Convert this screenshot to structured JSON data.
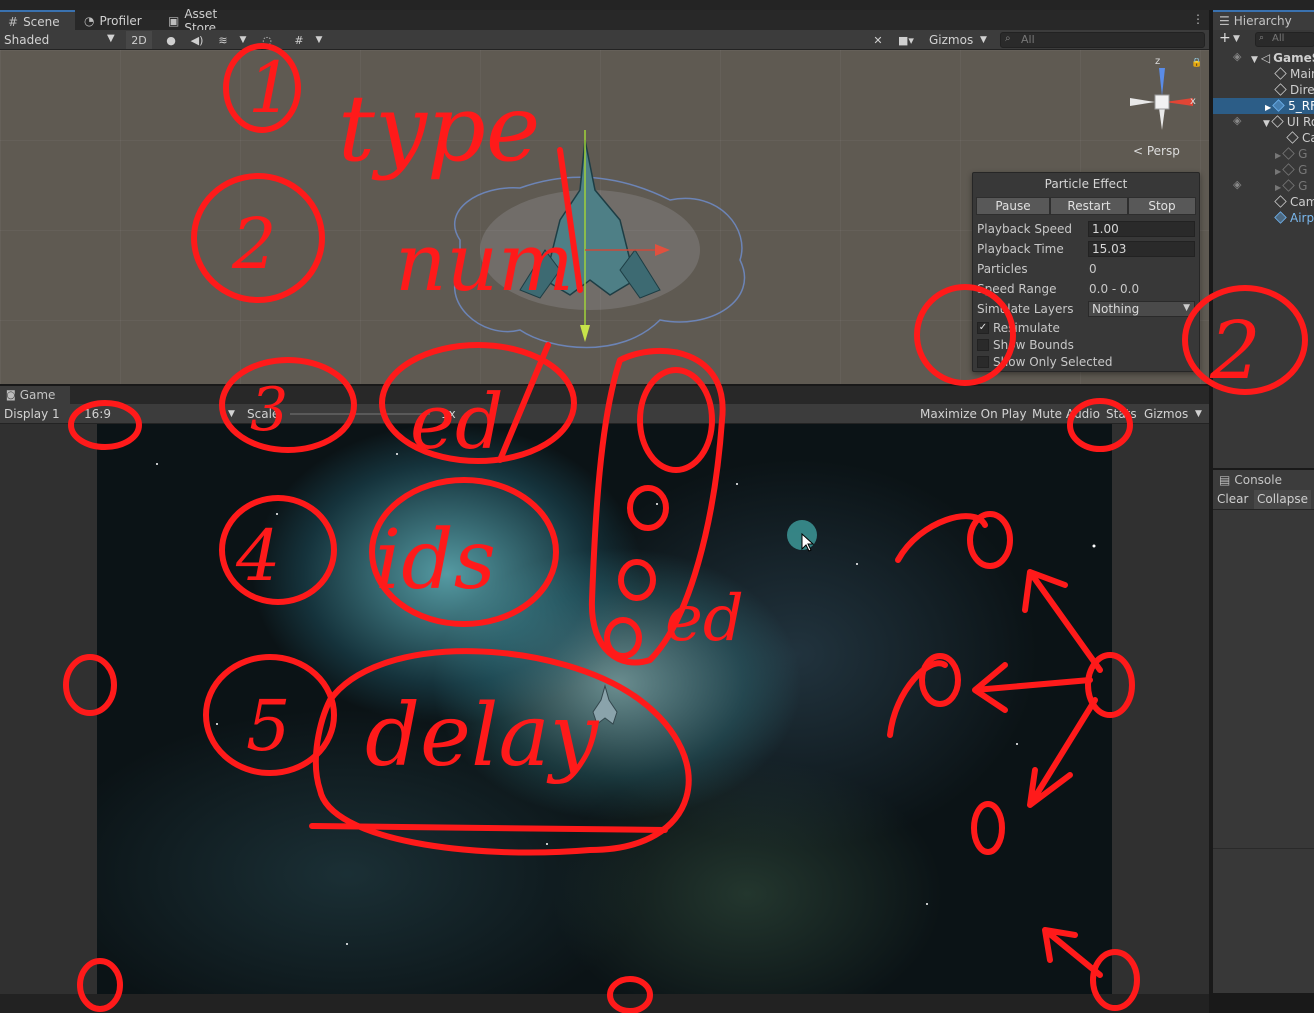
{
  "tabs": {
    "scene": "Scene",
    "profiler": "Profiler",
    "asset_store": "Asset Store",
    "game": "Game",
    "hierarchy": "Hierarchy",
    "console": "Console"
  },
  "scene_toolbar": {
    "shading_mode": "Shaded",
    "toggle_2d": "2D",
    "gizmos": "Gizmos",
    "search_placeholder": "All"
  },
  "orientation_gizmo": {
    "y_axis": "z",
    "x_axis": "x",
    "projection": "< Persp"
  },
  "particle_effect": {
    "title": "Particle Effect",
    "pause": "Pause",
    "restart": "Restart",
    "stop": "Stop",
    "playback_speed_label": "Playback Speed",
    "playback_speed": "1.00",
    "playback_time_label": "Playback Time",
    "playback_time": "15.03",
    "particles_label": "Particles",
    "particles": "0",
    "speed_range_label": "Speed Range",
    "speed_range": "0.0 - 0.0",
    "simulate_layers_label": "Simulate Layers",
    "simulate_layers": "Nothing",
    "resimulate": "Resimulate",
    "resimulate_checked": true,
    "show_bounds": "Show Bounds",
    "show_only_selected": "Show Only Selected"
  },
  "game_toolbar": {
    "display": "Display 1",
    "aspect": "16:9",
    "scale_label": "Scale",
    "scale_value": "1x",
    "maximize_on_play": "Maximize On Play",
    "mute_audio": "Mute Audio",
    "stats": "Stats",
    "gizmos": "Gizmos"
  },
  "hierarchy": {
    "search_placeholder": "All",
    "items": [
      {
        "label": "GameS",
        "level": 0,
        "type": "scene"
      },
      {
        "label": "Main",
        "level": 1,
        "type": "object"
      },
      {
        "label": "Direc",
        "level": 1,
        "type": "object"
      },
      {
        "label": "5_RF",
        "level": 1,
        "type": "prefab",
        "selected": true
      },
      {
        "label": "UI Ro",
        "level": 1,
        "type": "object"
      },
      {
        "label": "Ca",
        "level": 2,
        "type": "object"
      },
      {
        "label": "G",
        "level": 2,
        "type": "dim"
      },
      {
        "label": "G",
        "level": 2,
        "type": "dim"
      },
      {
        "label": "G",
        "level": 2,
        "type": "dim"
      },
      {
        "label": "Cam",
        "level": 1,
        "type": "object"
      },
      {
        "label": "Airpl",
        "level": 1,
        "type": "prefab"
      }
    ]
  },
  "console": {
    "clear": "Clear",
    "collapse": "Collapse"
  },
  "annotation_notes": {
    "n1": "1",
    "type": "type",
    "n2a": "2",
    "num": "num",
    "n2b": "2",
    "n3": "3",
    "ed": "ed",
    "n4": "4",
    "ids": "ids",
    "n5": "5",
    "delay": "delay",
    "ed2": "ed"
  },
  "colors": {
    "ink": "#ff0000",
    "selection": "#2c5d87",
    "panel": "#383838"
  }
}
